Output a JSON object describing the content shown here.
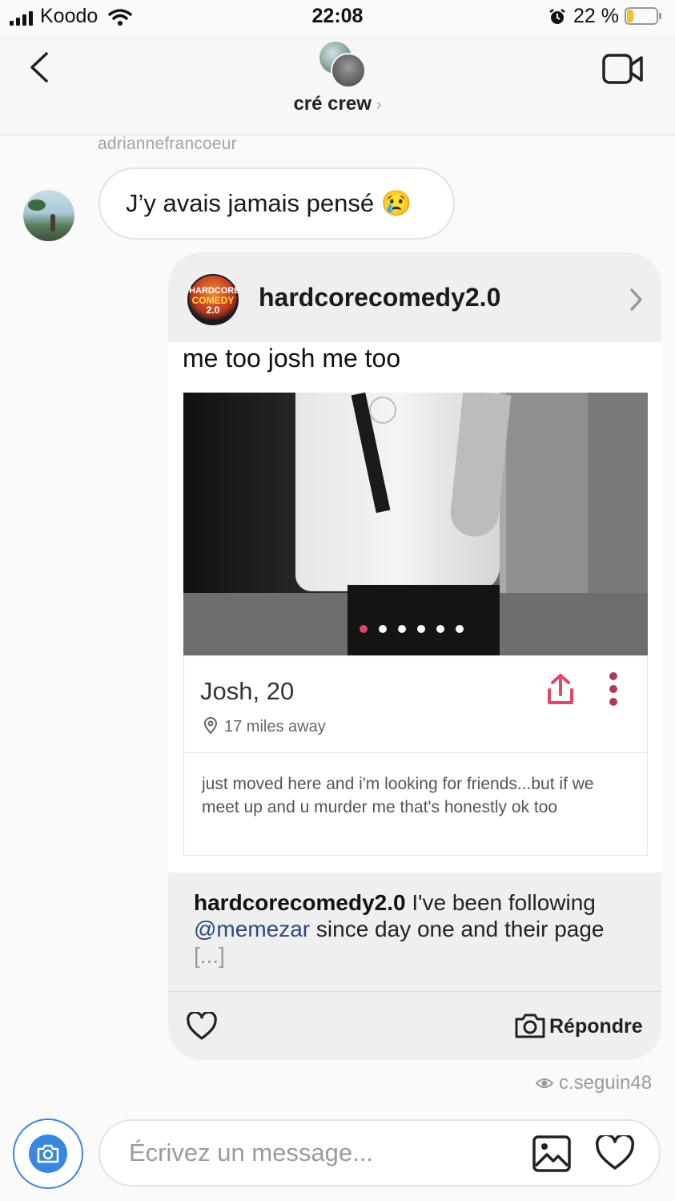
{
  "status_bar": {
    "carrier": "Koodo",
    "time": "22:08",
    "battery": "22 %",
    "battery_level": 0.22
  },
  "header": {
    "title": "cré crew",
    "title_chevron": "›"
  },
  "messages": {
    "sender": "adriannefrancoeur",
    "text": "J’y avais jamais pensé 😢"
  },
  "shared_post": {
    "username": "hardcorecomedy2.0",
    "logo_text": [
      "HARDCORE",
      "COMEDY",
      "2.0"
    ],
    "meme": {
      "caption": "me too josh me too",
      "carousel_dots": 6,
      "carousel_active": 1,
      "profile_name": "Josh, 20",
      "distance": "17 miles away",
      "bio": "just moved here and i'm looking for friends...but if we meet up and u murder me that's honestly ok too"
    },
    "caption_user": "hardcorecomedy2.0",
    "caption_text_1": " I've been following ",
    "caption_mention": "@memezar",
    "caption_text_2": " since day one and their page",
    "caption_ellipsis": "[...]",
    "reply_label": "Répondre"
  },
  "seen_by": "c.seguin48",
  "composer": {
    "placeholder": "Écrivez un message..."
  },
  "colors": {
    "accent": "#3a87de",
    "tinder_pink": "#e0476b",
    "mention": "#2b4a7d"
  }
}
